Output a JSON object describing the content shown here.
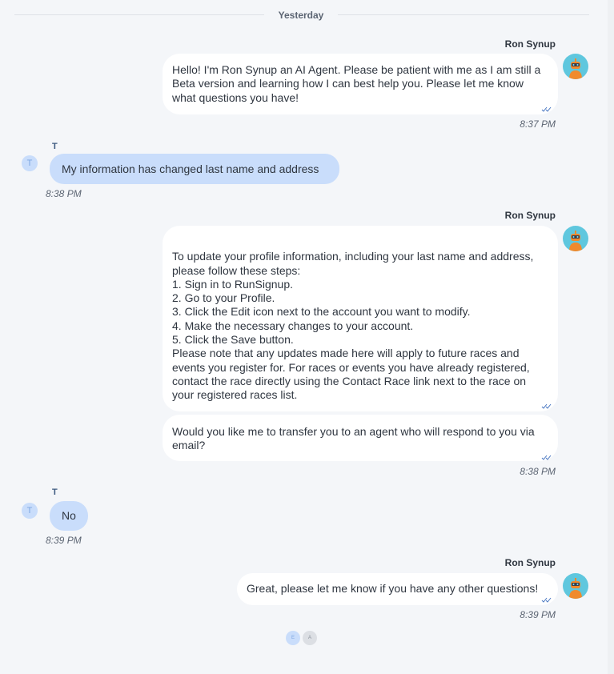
{
  "date_separator": "Yesterday",
  "messages": [
    {
      "sender": "Ron Synup",
      "bubbles": [
        {
          "text": "Hello! I'm Ron Synup an AI Agent. Please be patient with me as I am still a Beta version and learning how I can best help you. Please let me know what questions you have!"
        }
      ],
      "time": "8:37 PM"
    },
    {
      "sender": "T",
      "avatar_initial": "T",
      "text": "My information has changed last name and address",
      "time": "8:38 PM"
    },
    {
      "sender": "Ron Synup",
      "bubbles": [
        {
          "text": "To update your profile information, including your last name and address, please follow these steps:\n1. Sign in to RunSignup.\n2. Go to your Profile.\n3. Click the Edit icon next to the account you want to modify.\n4. Make the necessary changes to your account.\n5. Click the Save button.\nPlease note that any updates made here will apply to future races and events you register for. For races or events you have already registered, contact the race directly using the Contact Race link next to the race on your registered races list."
        },
        {
          "text": "Would you like me to transfer you to an agent who will respond to you via email?"
        }
      ],
      "time": "8:38 PM"
    },
    {
      "sender": "T",
      "avatar_initial": "T",
      "text": "No",
      "time": "8:39 PM"
    },
    {
      "sender": "Ron Synup",
      "bubbles": [
        {
          "text": "Great, please let me know if you have any other questions!"
        }
      ],
      "time": "8:39 PM"
    }
  ],
  "typing_indicator": [
    "E",
    "A"
  ],
  "colors": {
    "background": "#f4f6f9",
    "agent_bubble": "#ffffff",
    "user_bubble": "#c9ddfb",
    "read_tick": "#4a78c2",
    "bot_avatar": "#5fc7de",
    "bot_body": "#f08a2c"
  }
}
